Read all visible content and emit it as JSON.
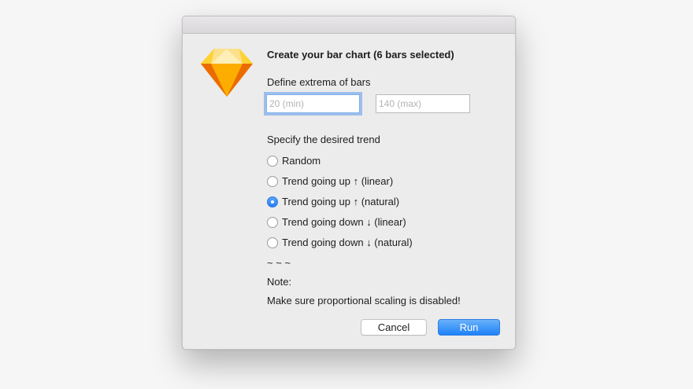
{
  "dialog": {
    "title": "Create your bar chart (6 bars selected)",
    "app_icon": "sketch-diamond-icon",
    "extrema_label": "Define extrema of bars",
    "min_field": {
      "value": "",
      "placeholder": "20 (min)"
    },
    "max_field": {
      "value": "",
      "placeholder": "140 (max)"
    },
    "trend_label": "Specify the desired trend",
    "trend_options": [
      {
        "label": "Random",
        "checked": false
      },
      {
        "label": "Trend going up ↑ (linear)",
        "checked": false
      },
      {
        "label": "Trend going up ↑ (natural)",
        "checked": true
      },
      {
        "label": "Trend going down ↓ (linear)",
        "checked": false
      },
      {
        "label": "Trend going down ↓ (natural)",
        "checked": false
      }
    ],
    "separator": "~ ~ ~",
    "note_label": "Note:",
    "note_text": "Make sure proportional scaling is disabled!",
    "cancel_label": "Cancel",
    "run_label": "Run"
  },
  "colors": {
    "accent": "#2b7ef1",
    "diamond_top": "#fde08a",
    "diamond_bottom": "#f59a1b"
  }
}
